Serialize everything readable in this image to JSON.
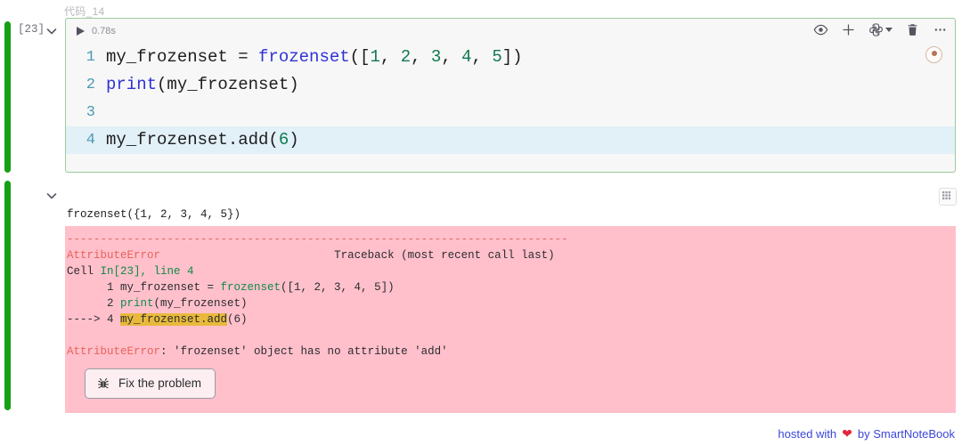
{
  "cell": {
    "title": "代码_14",
    "exec_count": "[23]",
    "run_time": "0.78s",
    "collapse_icon": "chevron-down-icon",
    "toolbar": {
      "preview_label": "eye-icon",
      "add_label": "plus-icon",
      "kernel_label": "python-kernel-icon",
      "delete_label": "trash-icon",
      "more_label": "ellipsis-icon"
    },
    "code_lines": [
      {
        "number": "1",
        "highlighted": false,
        "tokens": [
          {
            "t": "my_frozenset = ",
            "c": "t-plain"
          },
          {
            "t": "frozenset",
            "c": "t-builtin"
          },
          {
            "t": "([",
            "c": "t-plain"
          },
          {
            "t": "1",
            "c": "t-num"
          },
          {
            "t": ", ",
            "c": "t-plain"
          },
          {
            "t": "2",
            "c": "t-num"
          },
          {
            "t": ", ",
            "c": "t-plain"
          },
          {
            "t": "3",
            "c": "t-num"
          },
          {
            "t": ", ",
            "c": "t-plain"
          },
          {
            "t": "4",
            "c": "t-num"
          },
          {
            "t": ", ",
            "c": "t-plain"
          },
          {
            "t": "5",
            "c": "t-num"
          },
          {
            "t": "])",
            "c": "t-plain"
          }
        ]
      },
      {
        "number": "2",
        "highlighted": false,
        "tokens": [
          {
            "t": "print",
            "c": "t-builtin"
          },
          {
            "t": "(my_frozenset)",
            "c": "t-plain"
          }
        ]
      },
      {
        "number": "3",
        "highlighted": false,
        "tokens": []
      },
      {
        "number": "4",
        "highlighted": true,
        "tokens": [
          {
            "t": "my_frozenset.add(",
            "c": "t-plain"
          },
          {
            "t": "6",
            "c": "t-num"
          },
          {
            "t": ")",
            "c": "t-plain"
          }
        ]
      }
    ]
  },
  "output": {
    "collapse_icon": "chevron-down-icon",
    "corner_icon": "matrix-grid-icon",
    "stdout": "frozenset({1, 2, 3, 4, 5})",
    "dashes": "---------------------------------------------------------------------------",
    "traceback": [
      {
        "id": "header",
        "segments": [
          {
            "t": "AttributeError",
            "c": "c-errname"
          },
          {
            "t": "                          Traceback (most recent call last)",
            "c": "c-dark"
          }
        ]
      },
      {
        "id": "cell-ref",
        "segments": [
          {
            "t": "Cell ",
            "c": "c-dark"
          },
          {
            "t": "In[23], line 4",
            "c": "c-green"
          }
        ]
      },
      {
        "id": "frame-1",
        "segments": [
          {
            "t": "      1 my_frozenset = ",
            "c": "c-dark"
          },
          {
            "t": "frozenset",
            "c": "c-green"
          },
          {
            "t": "([1, 2, 3, 4, 5])",
            "c": "c-dark"
          }
        ]
      },
      {
        "id": "frame-2",
        "segments": [
          {
            "t": "      2 ",
            "c": "c-dark"
          },
          {
            "t": "print",
            "c": "c-green"
          },
          {
            "t": "(my_frozenset)",
            "c": "c-dark"
          }
        ]
      },
      {
        "id": "frame-4",
        "segments": [
          {
            "t": "----> 4 ",
            "c": "c-arrow"
          },
          {
            "t": "my_frozenset.add",
            "c": "c-dark hl-yellow"
          },
          {
            "t": "(6)",
            "c": "c-dark"
          }
        ]
      }
    ],
    "error_message": [
      {
        "t": "AttributeError",
        "c": "c-errname"
      },
      {
        "t": ": 'frozenset' object has no attribute 'add'",
        "c": "c-dark"
      }
    ],
    "fix_button": {
      "label": "Fix the problem",
      "icon": "bug-icon"
    }
  },
  "footer": {
    "prefix": "hosted with",
    "heart": "❤",
    "suffix": "by SmartNoteBook"
  },
  "colors": {
    "gutter_green": "#16a016",
    "cell_border_green": "#9ccb9c",
    "error_bg": "#ffc0cb",
    "highlight_line": "#e2f0f7",
    "highlight_token": "#e8b93c",
    "footer_text": "#3b46d8",
    "heart": "#e8243c"
  }
}
